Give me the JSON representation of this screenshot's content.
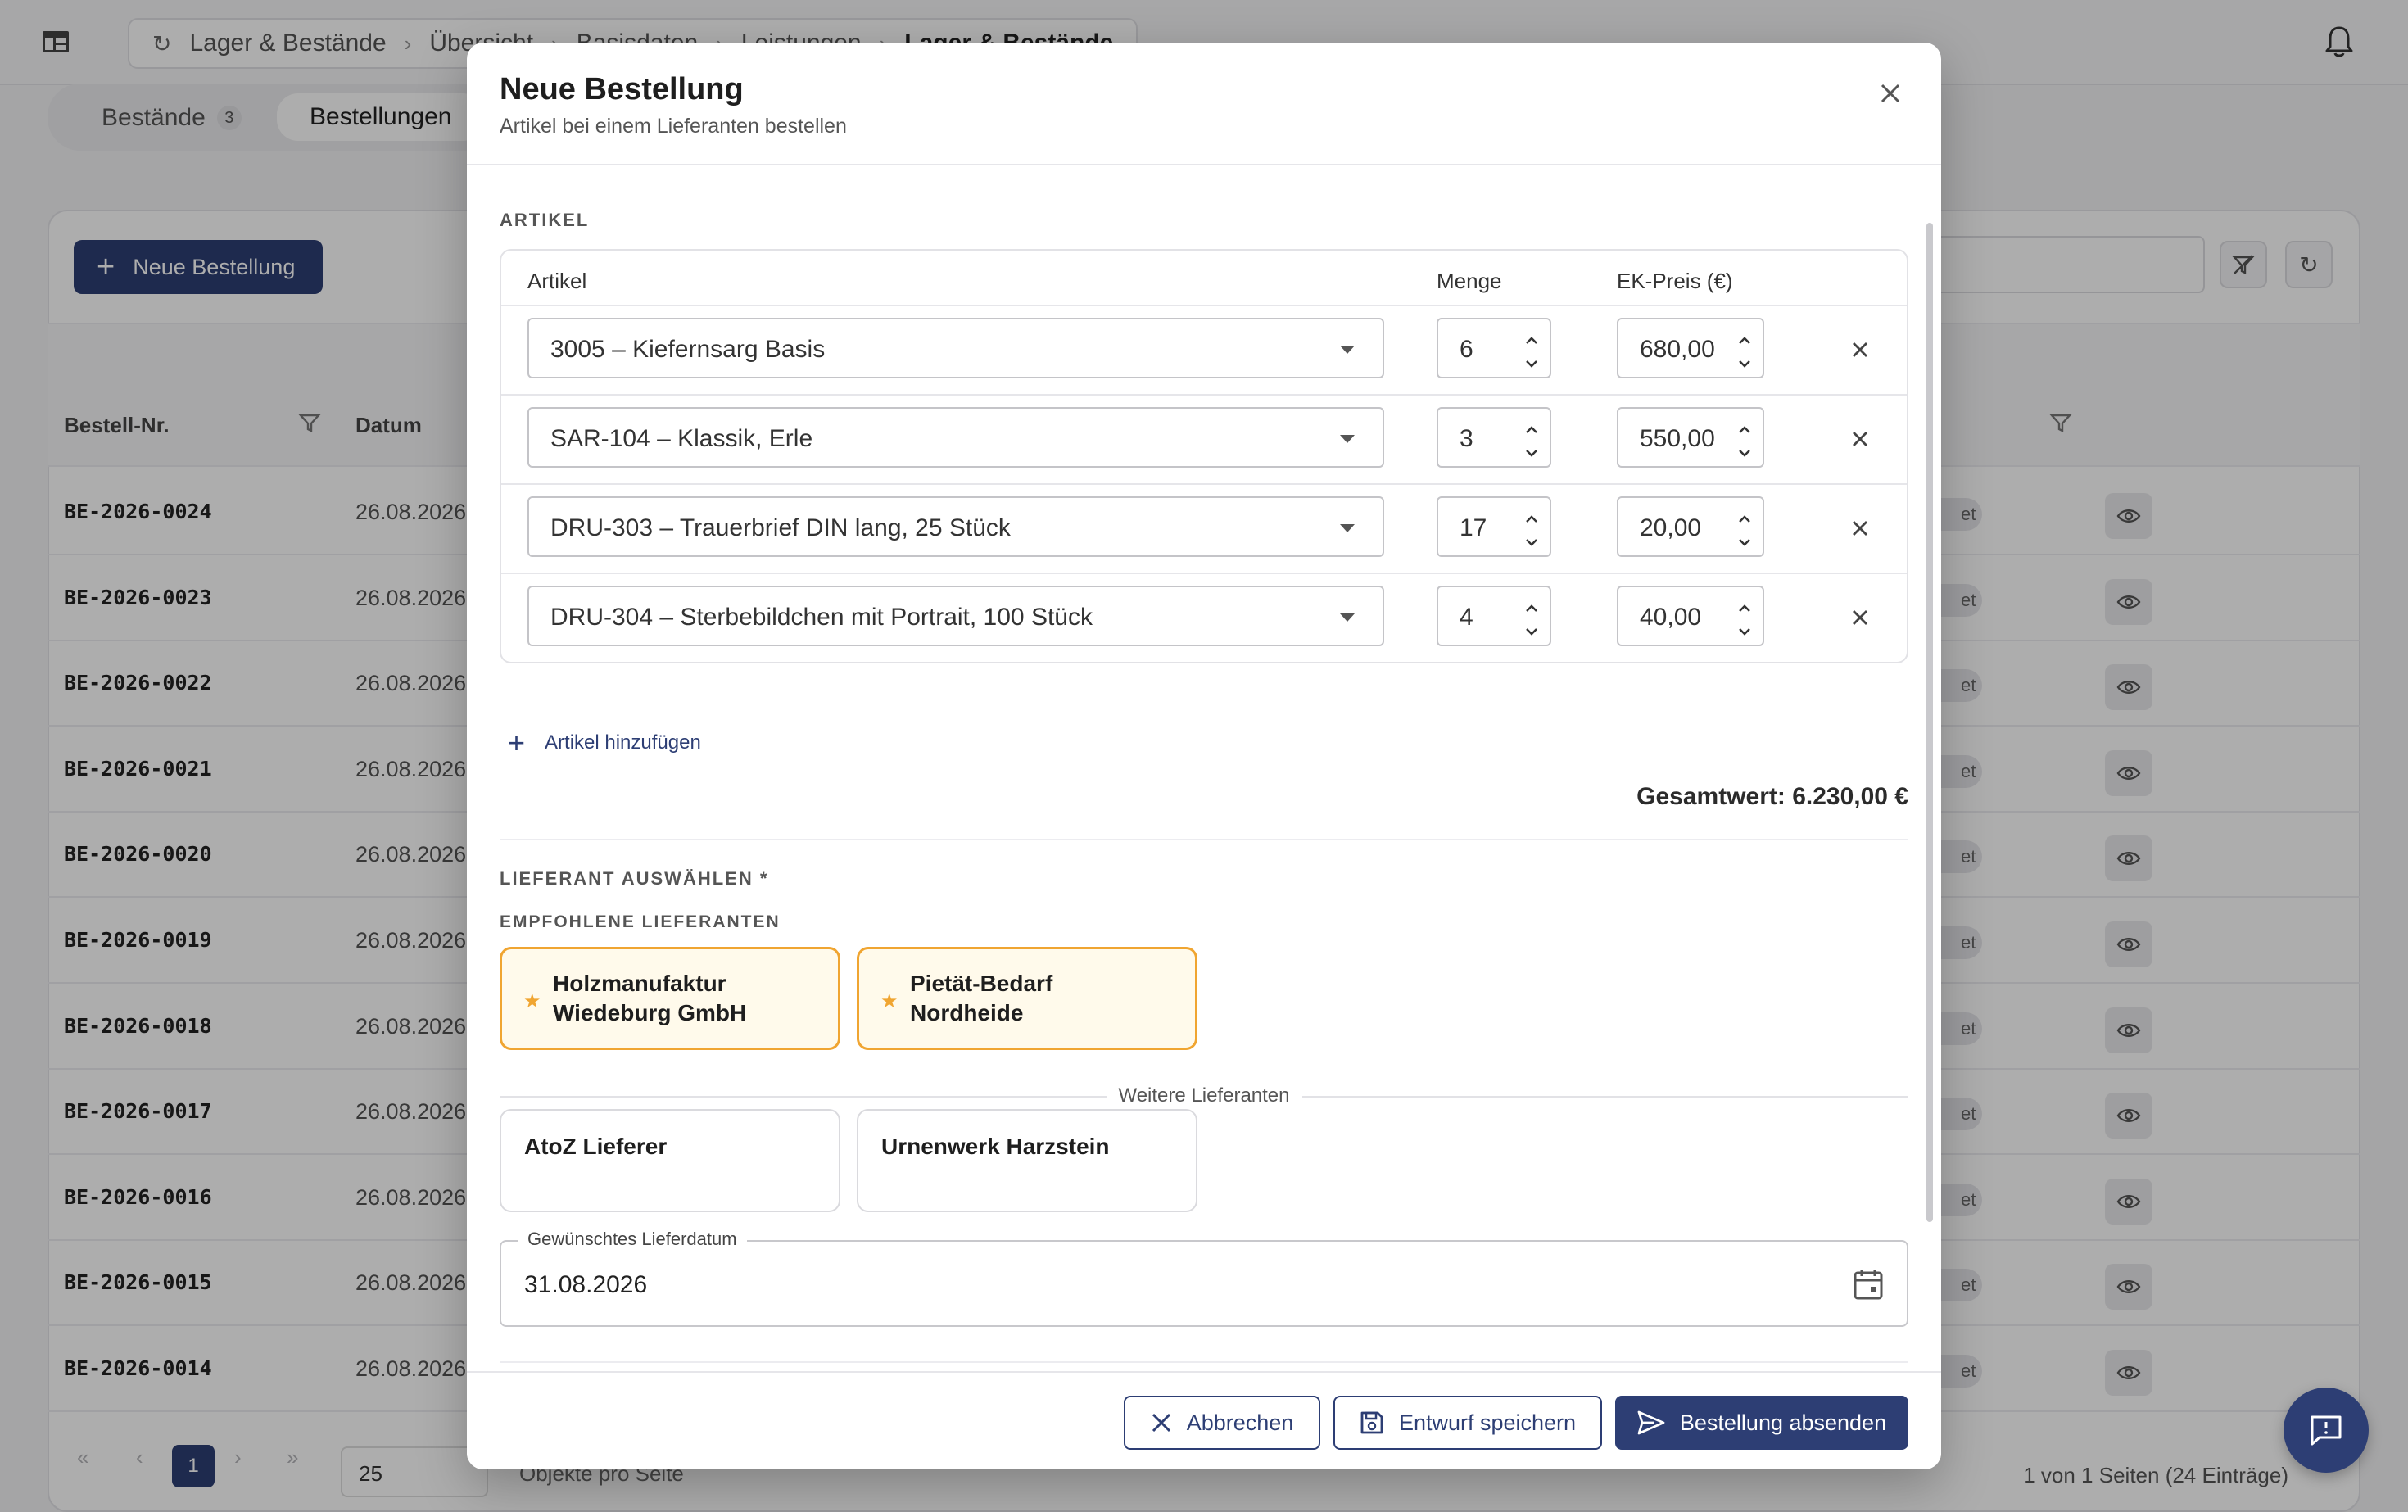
{
  "breadcrumb": [
    "Lager & Bestände",
    "Übersicht",
    "Basisdaten",
    "Leistungen",
    "Lager & Bestände"
  ],
  "tabs": [
    {
      "label": "Bestände",
      "count": "3"
    },
    {
      "label": "Bestellungen"
    }
  ],
  "toolbar": {
    "new_order": "Neue Bestellung"
  },
  "table": {
    "headers": {
      "nr": "Bestell-Nr.",
      "date": "Datum"
    },
    "status_fragment": "et",
    "rows": [
      {
        "nr": "BE-2026-0024",
        "date": "26.08.2026"
      },
      {
        "nr": "BE-2026-0023",
        "date": "26.08.2026"
      },
      {
        "nr": "BE-2026-0022",
        "date": "26.08.2026"
      },
      {
        "nr": "BE-2026-0021",
        "date": "26.08.2026"
      },
      {
        "nr": "BE-2026-0020",
        "date": "26.08.2026"
      },
      {
        "nr": "BE-2026-0019",
        "date": "26.08.2026"
      },
      {
        "nr": "BE-2026-0018",
        "date": "26.08.2026"
      },
      {
        "nr": "BE-2026-0017",
        "date": "26.08.2026"
      },
      {
        "nr": "BE-2026-0016",
        "date": "26.08.2026"
      },
      {
        "nr": "BE-2026-0015",
        "date": "26.08.2026"
      },
      {
        "nr": "BE-2026-0014",
        "date": "26.08.2026"
      }
    ]
  },
  "pager": {
    "first": "«",
    "prev": "‹",
    "page": "1",
    "next": "›",
    "last": "»",
    "size": "25",
    "size_label": "Objekte pro Seite",
    "info": "1 von 1 Seiten (24 Einträge)"
  },
  "modal": {
    "title": "Neue Bestellung",
    "subtitle": "Artikel bei einem Lieferanten bestellen",
    "items_section": "ARTIKEL",
    "col_article": "Artikel",
    "col_qty": "Menge",
    "col_price": "EK-Preis (€)",
    "items": [
      {
        "article": "3005 – Kiefernsarg Basis",
        "qty": "6",
        "price": "680,00"
      },
      {
        "article": "SAR-104 – Klassik, Erle",
        "qty": "3",
        "price": "550,00"
      },
      {
        "article": "DRU-303 – Trauerbrief DIN lang, 25 Stück",
        "qty": "17",
        "price": "20,00"
      },
      {
        "article": "DRU-304 – Sterbebildchen mit Portrait, 100 Stück",
        "qty": "4",
        "price": "40,00"
      }
    ],
    "add_item": "Artikel hinzufügen",
    "total": "Gesamtwert: 6.230,00 €",
    "supplier_section": "LIEFERANT AUSWÄHLEN *",
    "recommended_section": "EMPFOHLENE LIEFERANTEN",
    "recommended": [
      {
        "line1": "Holzmanufaktur",
        "line2": "Wiedeburg GmbH"
      },
      {
        "line1": "Pietät-Bedarf",
        "line2": "Nordheide"
      }
    ],
    "more_label": "Weitere Lieferanten",
    "more": [
      "AtoZ Lieferer",
      "Urnenwerk Harzstein"
    ],
    "date_label": "Gewünschtes Lieferdatum",
    "date_value": "31.08.2026",
    "cancel": "Abbrechen",
    "save_draft": "Entwurf speichern",
    "submit": "Bestellung absenden"
  },
  "colors": {
    "primary": "#2d3e74",
    "favorite": "#f0a531",
    "favorite_bg": "#fffaeb"
  }
}
